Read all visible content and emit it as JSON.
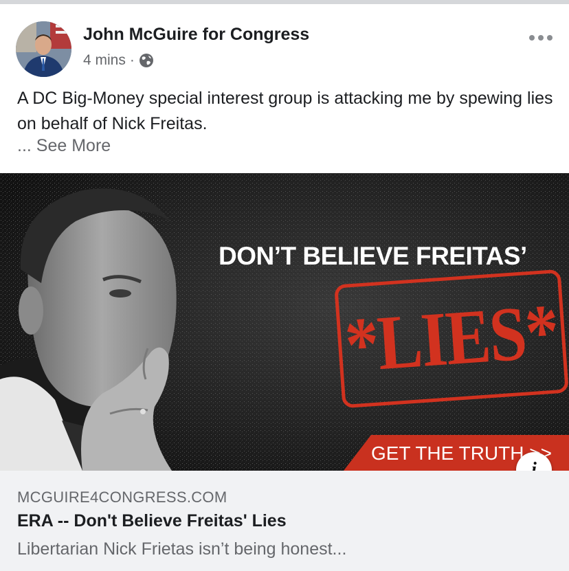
{
  "post": {
    "author": "John McGuire for Congress",
    "time": "4 mins",
    "separator": "·",
    "caption": "A DC Big-Money special interest group is attacking me by spewing lies on behalf of Nick Freitas.",
    "see_more": "... See More"
  },
  "ad_image": {
    "headline": "DON’T BELIEVE FREITAS’",
    "stamp_text": "*LIES*",
    "cta": "GET THE TRUTH >>"
  },
  "link": {
    "domain": "MCGUIRE4CONGRESS.COM",
    "title": "ERA -- Don't Believe Freitas' Lies",
    "description": "Libertarian Nick Frietas isn’t being honest..."
  },
  "icons": {
    "privacy": "globe-icon",
    "menu": "more-options-icon",
    "info": "info-icon"
  },
  "colors": {
    "accent_red": "#c9311f",
    "text_primary": "#1c1e21",
    "text_secondary": "#65676b",
    "link_background": "#f1f2f4"
  }
}
